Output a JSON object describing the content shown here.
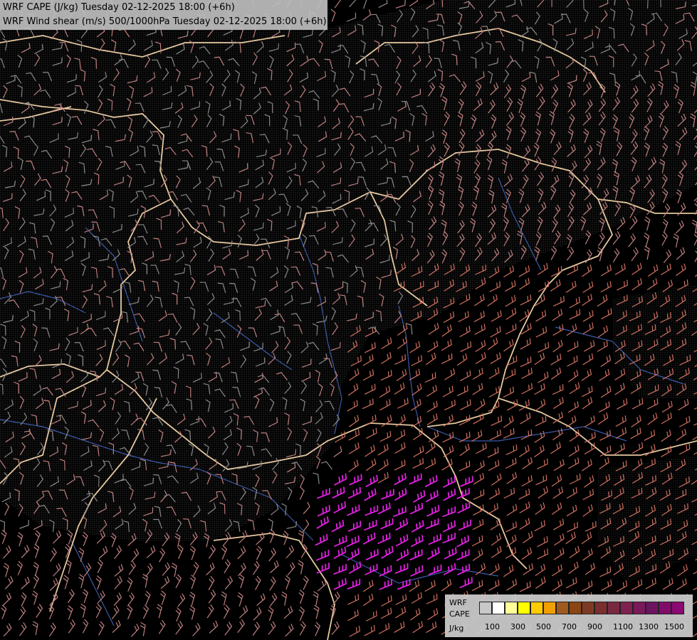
{
  "header": {
    "title_cape": "WRF CAPE (J/kg) Tuesday 02-12-2025 18:00 (+6h)",
    "title_shear": "WRF Wind shear (m/s) 500/1000hPa Tuesday 02-12-2025 18:00 (+6h)"
  },
  "legend": {
    "line1": "WRF",
    "line2": "CAPE",
    "unit": "J/kg",
    "ticks": [
      "100",
      "300",
      "500",
      "700",
      "900",
      "1100",
      "1300",
      "1500"
    ],
    "colors": [
      "#c8c8c8",
      "#ffffff",
      "#ffff99",
      "#ffff00",
      "#ffcc00",
      "#f0a000",
      "#a05a1e",
      "#8b4513",
      "#7f3a24",
      "#7a2e30",
      "#7a2840",
      "#802050",
      "#7a1a5a",
      "#6e1262",
      "#800c6a",
      "#8a0870"
    ]
  },
  "map": {
    "background": "#000000",
    "border_color": "#e8c8a0",
    "river_color": "#4060b0",
    "barb_colors": {
      "weak": "#8a8a8a",
      "moderate": "#c08080",
      "strong": "#d07060",
      "very_strong": "#e020e0"
    }
  }
}
